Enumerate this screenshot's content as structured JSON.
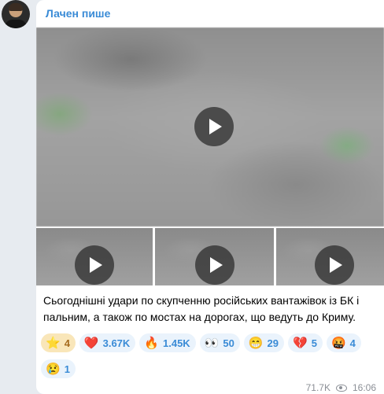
{
  "post": {
    "author": "Лачен пише",
    "text": "Сьогоднішні удари по скупченню російських вантажівок із БК і пальним, а також по мостах на дорогах, що ведуть до Криму.",
    "views": "71.7K",
    "time": "16:06"
  },
  "reactions": [
    {
      "emoji": "⭐",
      "count": "4",
      "kind": "star"
    },
    {
      "emoji": "❤️",
      "count": "3.67K"
    },
    {
      "emoji": "🔥",
      "count": "1.45K"
    },
    {
      "emoji": "👀",
      "count": "50"
    },
    {
      "emoji": "😁",
      "count": "29"
    },
    {
      "emoji": "💔",
      "count": "5"
    },
    {
      "emoji": "🤬",
      "count": "4"
    },
    {
      "emoji": "😢",
      "count": "1"
    }
  ],
  "icons": {
    "play": "play-icon",
    "views": "eye-icon"
  }
}
